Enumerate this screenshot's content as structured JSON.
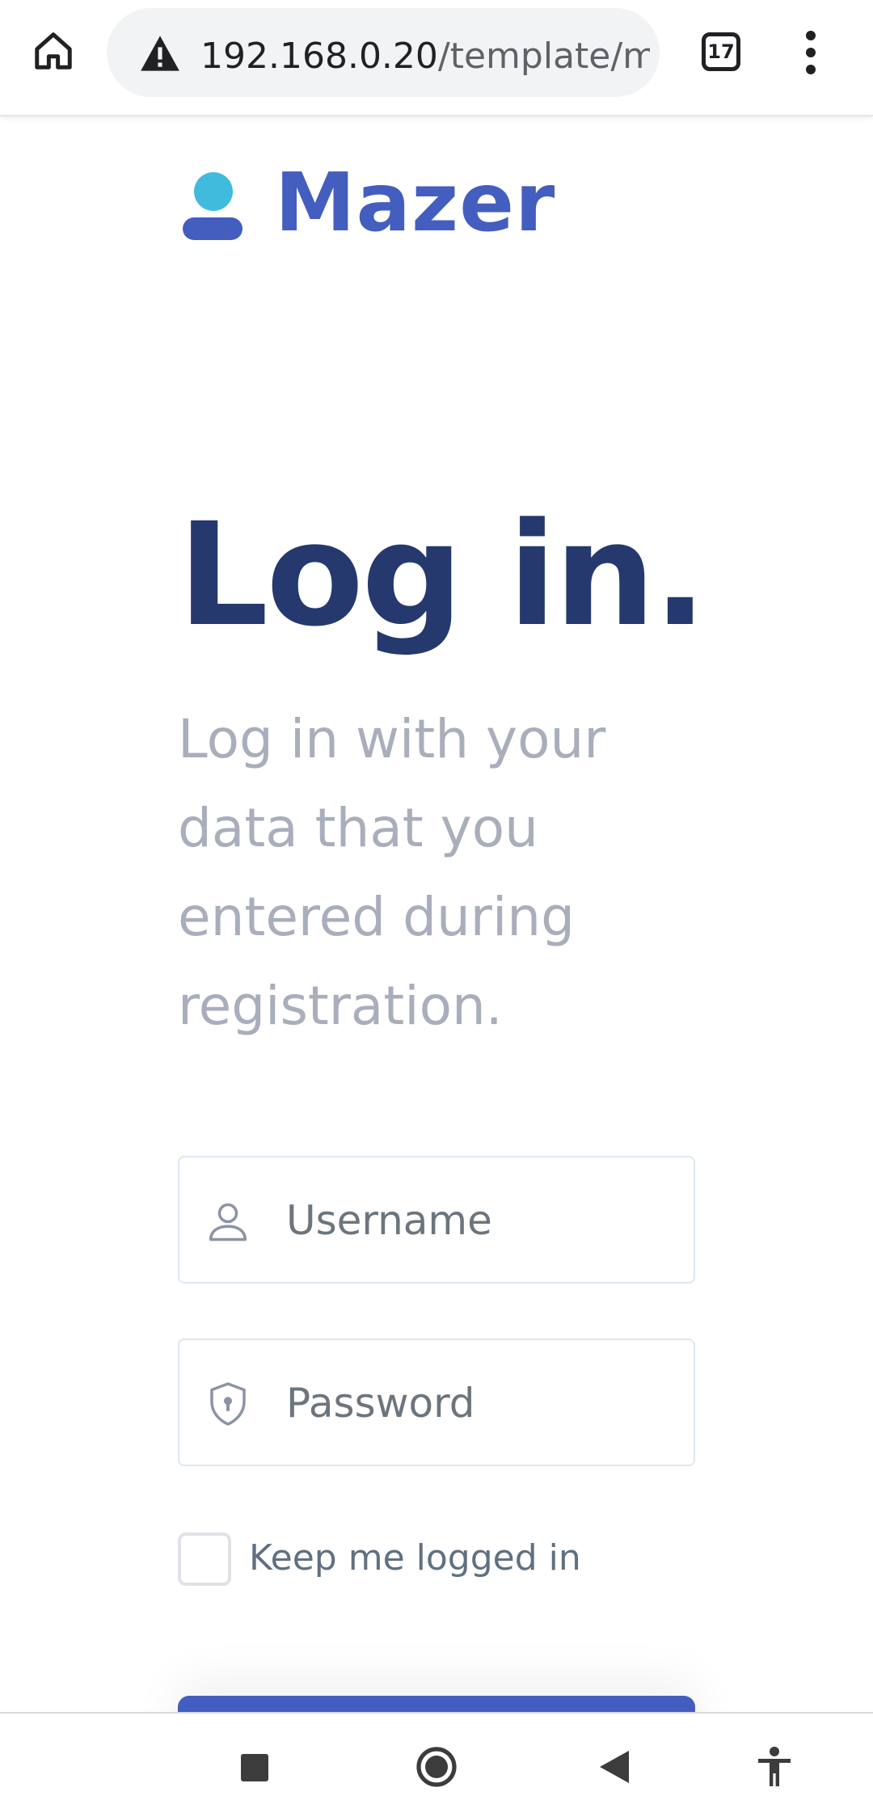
{
  "browser": {
    "url_host": "192.168.0.20",
    "url_path": "/template/m",
    "tab_count": "17",
    "icons": {
      "home": "home-icon",
      "security": "warning-icon",
      "menu": "more-vert-icon"
    }
  },
  "brand": {
    "name": "Mazer",
    "colors": {
      "primary": "#435ebe",
      "accent": "#41bbdd",
      "heading": "#25396f"
    }
  },
  "login": {
    "title": "Log in.",
    "subtitle": "Log in with your data that you entered during registration.",
    "username_placeholder": "Username",
    "password_placeholder": "Password",
    "remember_label": "Keep me logged in",
    "remember_checked": false,
    "submit_label": ""
  },
  "nav": {
    "icons": [
      "recents-icon",
      "home-circle-icon",
      "back-icon",
      "accessibility-icon"
    ]
  }
}
